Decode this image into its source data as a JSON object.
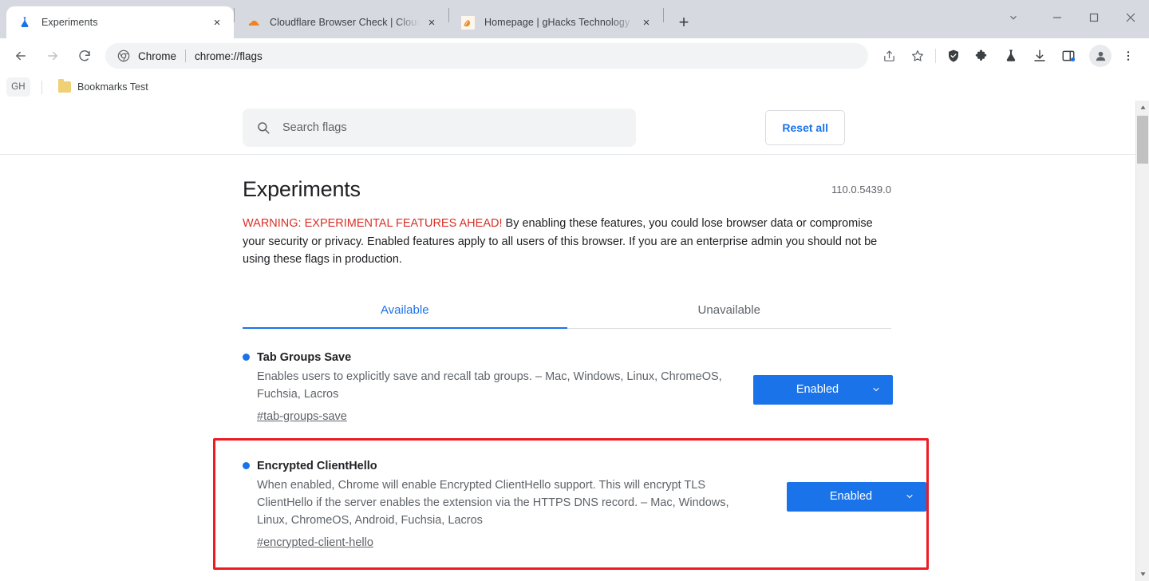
{
  "window": {
    "controls": [
      {
        "name": "tab-search",
        "glyph": "chevron-down"
      },
      {
        "name": "minimize",
        "glyph": "minimize"
      },
      {
        "name": "maximize",
        "glyph": "maximize"
      },
      {
        "name": "close",
        "glyph": "close"
      }
    ]
  },
  "tabs": [
    {
      "title": "Experiments",
      "favicon": "flask-icon",
      "active": true,
      "close_label": "×"
    },
    {
      "title": "Cloudflare Browser Check | Cloud",
      "favicon": "cloudflare-icon",
      "active": false,
      "close_label": "×"
    },
    {
      "title": "Homepage | gHacks Technology",
      "favicon": "ghacks-icon",
      "active": false,
      "close_label": "×"
    }
  ],
  "new_tab_label": "+",
  "toolbar": {
    "back_label": "←",
    "forward_label": "→",
    "reload_label": "⟳",
    "omnibox": {
      "scheme_label": "Chrome",
      "url": "chrome://flags",
      "site_icon": "chrome-logo-icon"
    },
    "actions": [
      {
        "name": "share-icon"
      },
      {
        "name": "bookmark-star-icon"
      },
      {
        "name": "shield-check-icon"
      },
      {
        "name": "extensions-puzzle-icon"
      },
      {
        "name": "flask-experiments-icon"
      },
      {
        "name": "downloads-icon"
      },
      {
        "name": "side-panel-icon"
      },
      {
        "name": "profile-avatar-icon"
      },
      {
        "name": "chrome-menu-icon"
      }
    ]
  },
  "bookmarks_bar": {
    "profile_chip": "GH",
    "items": [
      {
        "label": "Bookmarks Test",
        "icon": "folder-icon"
      }
    ]
  },
  "flags_page": {
    "search": {
      "placeholder": "Search flags",
      "value": "",
      "icon": "search-icon"
    },
    "reset_all_label": "Reset all",
    "title": "Experiments",
    "version": "110.0.5439.0",
    "warning_strong": "WARNING: EXPERIMENTAL FEATURES AHEAD!",
    "warning_rest": " By enabling these features, you could lose browser data or compromise your security or privacy. Enabled features apply to all users of this browser. If you are an enterprise admin you should not be using these flags in production.",
    "tabs": [
      {
        "label": "Available",
        "selected": true
      },
      {
        "label": "Unavailable",
        "selected": false
      }
    ],
    "entries": [
      {
        "name": "Tab Groups Save",
        "description": "Enables users to explicitly save and recall tab groups. – Mac, Windows, Linux, ChromeOS, Fuchsia, Lacros",
        "anchor": "#tab-groups-save",
        "state": "Enabled",
        "highlighted": false
      },
      {
        "name": "Encrypted ClientHello",
        "description": "When enabled, Chrome will enable Encrypted ClientHello support. This will encrypt TLS ClientHello if the server enables the extension via the HTTPS DNS record. – Mac, Windows, Linux, ChromeOS, Android, Fuchsia, Lacros",
        "anchor": "#encrypted-client-hello",
        "state": "Enabled",
        "highlighted": true
      }
    ]
  },
  "colors": {
    "accent_blue": "#1a73e8",
    "warning_red": "#d93025",
    "highlight_red": "#ee1b24",
    "chrome_frame": "#d6dae0"
  }
}
